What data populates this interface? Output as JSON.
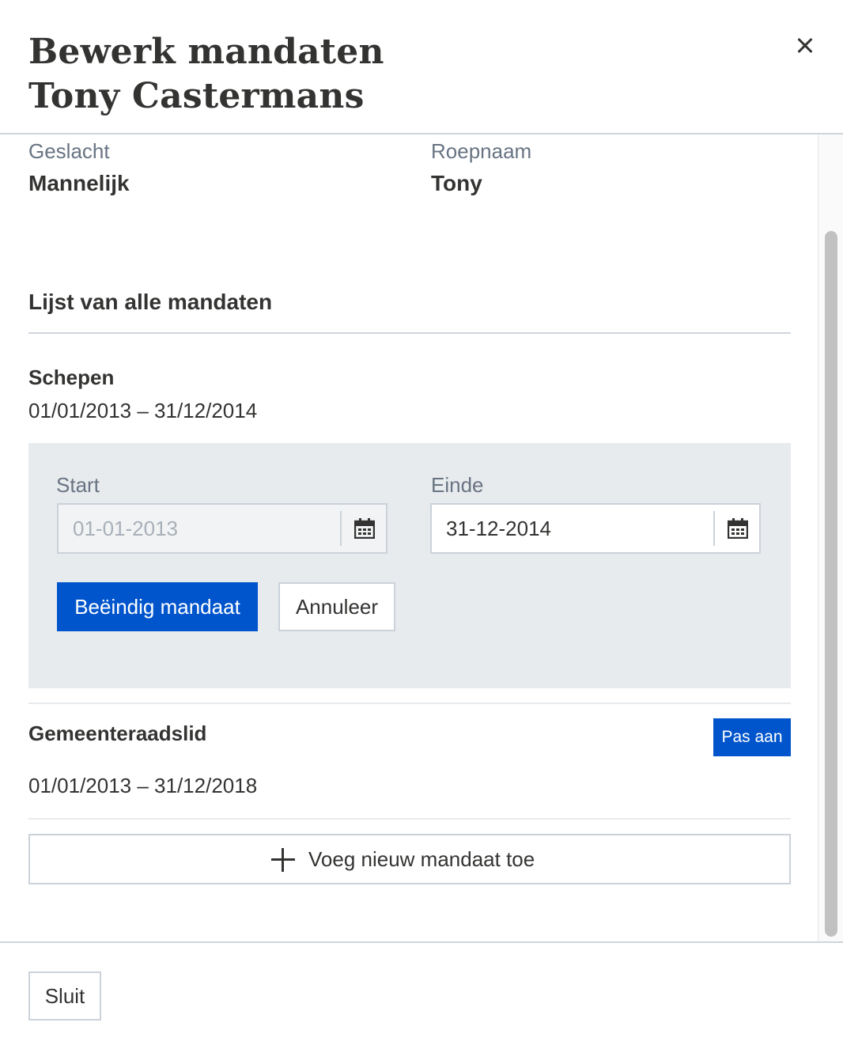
{
  "modal": {
    "title_line1": "Bewerk mandaten",
    "title_line2": "Tony Castermans",
    "close_icon": "close-icon"
  },
  "person": {
    "gender_label": "Geslacht",
    "gender_value": "Mannelijk",
    "nickname_label": "Roepnaam",
    "nickname_value": "Tony"
  },
  "mandates": {
    "section_title": "Lijst van alle mandaten",
    "items": [
      {
        "name": "Schepen",
        "dates": "01/01/2013 – 31/12/2014",
        "edit": {
          "start_label": "Start",
          "start_value": "01-01-2013",
          "end_label": "Einde",
          "end_value": "31-12-2014",
          "end_button": "Beëindig mandaat",
          "cancel_button": "Annuleer",
          "calendar_icon": "calendar-icon"
        }
      },
      {
        "name": "Gemeenteraadslid",
        "dates": "01/01/2013 – 31/12/2018",
        "edit_button": "Pas aan"
      }
    ],
    "add_button": "Voeg nieuw mandaat toe",
    "add_icon": "plus-icon"
  },
  "footer": {
    "close_button": "Sluit"
  },
  "colors": {
    "primary": "#0055cc",
    "text": "#333332",
    "muted": "#687483",
    "panel": "#e8ebee",
    "border": "#cbd2da"
  }
}
